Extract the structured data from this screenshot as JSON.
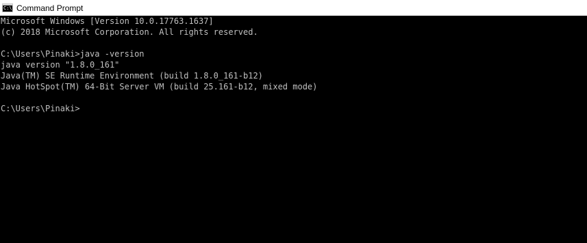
{
  "window": {
    "title": "Command Prompt",
    "icon": "command-prompt-icon",
    "icon_glyph": "C:\\"
  },
  "colors": {
    "console_background": "#000000",
    "console_text": "#c0c0c0",
    "titlebar_background": "#ffffff",
    "titlebar_text": "#000000"
  },
  "console": {
    "lines": [
      "Microsoft Windows [Version 10.0.17763.1637]",
      "(c) 2018 Microsoft Corporation. All rights reserved.",
      "",
      "C:\\Users\\Pinaki>java -version",
      "java version \"1.8.0_161\"",
      "Java(TM) SE Runtime Environment (build 1.8.0_161-b12)",
      "Java HotSpot(TM) 64-Bit Server VM (build 25.161-b12, mixed mode)",
      "",
      "C:\\Users\\Pinaki>"
    ]
  }
}
